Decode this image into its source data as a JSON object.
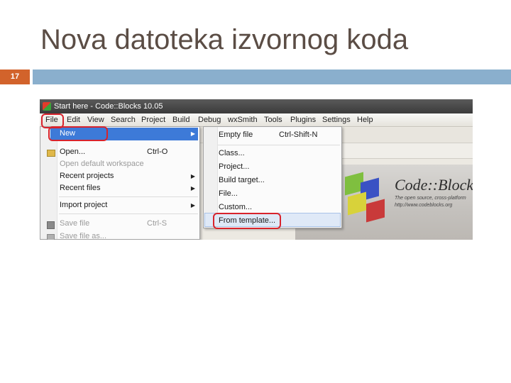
{
  "slide": {
    "title": "Nova datoteka izvornog koda",
    "slide_number": "17"
  },
  "window": {
    "title": "Start here - Code::Blocks 10.05"
  },
  "menubar": {
    "items": [
      "File",
      "Edit",
      "View",
      "Search",
      "Project",
      "Build",
      "Debug",
      "wxSmith",
      "Tools",
      "Plugins",
      "Settings",
      "Help"
    ]
  },
  "file_menu": {
    "new": "New",
    "open": "Open...",
    "open_shortcut": "Ctrl-O",
    "open_default_workspace": "Open default workspace",
    "recent_projects": "Recent projects",
    "recent_files": "Recent files",
    "import_project": "Import project",
    "save_file": "Save file",
    "save_shortcut": "Ctrl-S",
    "save_file_as": "Save file as..."
  },
  "new_menu": {
    "empty_file": "Empty file",
    "empty_file_shortcut": "Ctrl-Shift-N",
    "class": "Class...",
    "project": "Project...",
    "build_target": "Build target...",
    "file": "File...",
    "custom": "Custom...",
    "from_template": "From template..."
  },
  "splash": {
    "title": "Code::Blocks",
    "subtitle": "The open source, cross-platform",
    "url": "http://www.codeblocks.org"
  },
  "colors": {
    "title_text": "#5b4d45",
    "number_box": "#d2632b",
    "title_bar": "#8aafcd",
    "highlight_ring": "#d8232c",
    "menu_selection": "#3d7ad8"
  }
}
